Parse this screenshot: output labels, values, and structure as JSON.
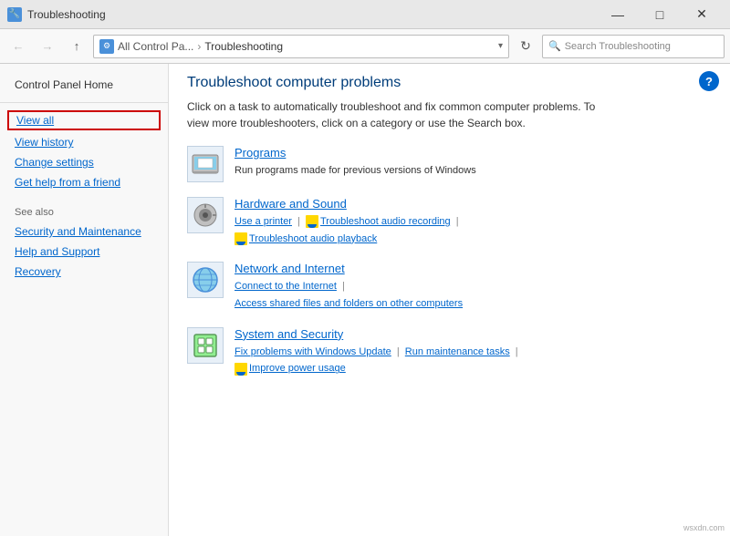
{
  "window": {
    "title": "Troubleshooting",
    "icon": "🔧"
  },
  "titlebar": {
    "minimize": "—",
    "maximize": "□",
    "close": "✕"
  },
  "addressbar": {
    "breadcrumb_prefix": "All Control Pa...",
    "breadcrumb_current": "Troubleshooting",
    "search_placeholder": "Search Troubleshooting"
  },
  "sidebar": {
    "home_label": "Control Panel Home",
    "view_all_label": "View all",
    "view_history_label": "View history",
    "change_settings_label": "Change settings",
    "get_help_label": "Get help from a friend",
    "see_also_label": "See also",
    "security_label": "Security and Maintenance",
    "help_label": "Help and Support",
    "recovery_label": "Recovery"
  },
  "content": {
    "title": "Troubleshoot computer problems",
    "description": "Click on a task to automatically troubleshoot and fix common computer problems. To view more troubleshooters, click on a category or use the Search box.",
    "categories": [
      {
        "name": "programs",
        "title": "Programs",
        "description": "Run programs made for previous versions of Windows",
        "links": []
      },
      {
        "name": "hardware-sound",
        "title": "Hardware and Sound",
        "description": "",
        "links": [
          "Use a printer",
          "Troubleshoot audio recording",
          "Troubleshoot audio playback"
        ]
      },
      {
        "name": "network-internet",
        "title": "Network and Internet",
        "description": "",
        "links": [
          "Connect to the Internet",
          "Access shared files and folders on other computers"
        ]
      },
      {
        "name": "system-security",
        "title": "System and Security",
        "description": "",
        "links": [
          "Fix problems with Windows Update",
          "Run maintenance tasks",
          "Improve power usage"
        ]
      }
    ]
  }
}
